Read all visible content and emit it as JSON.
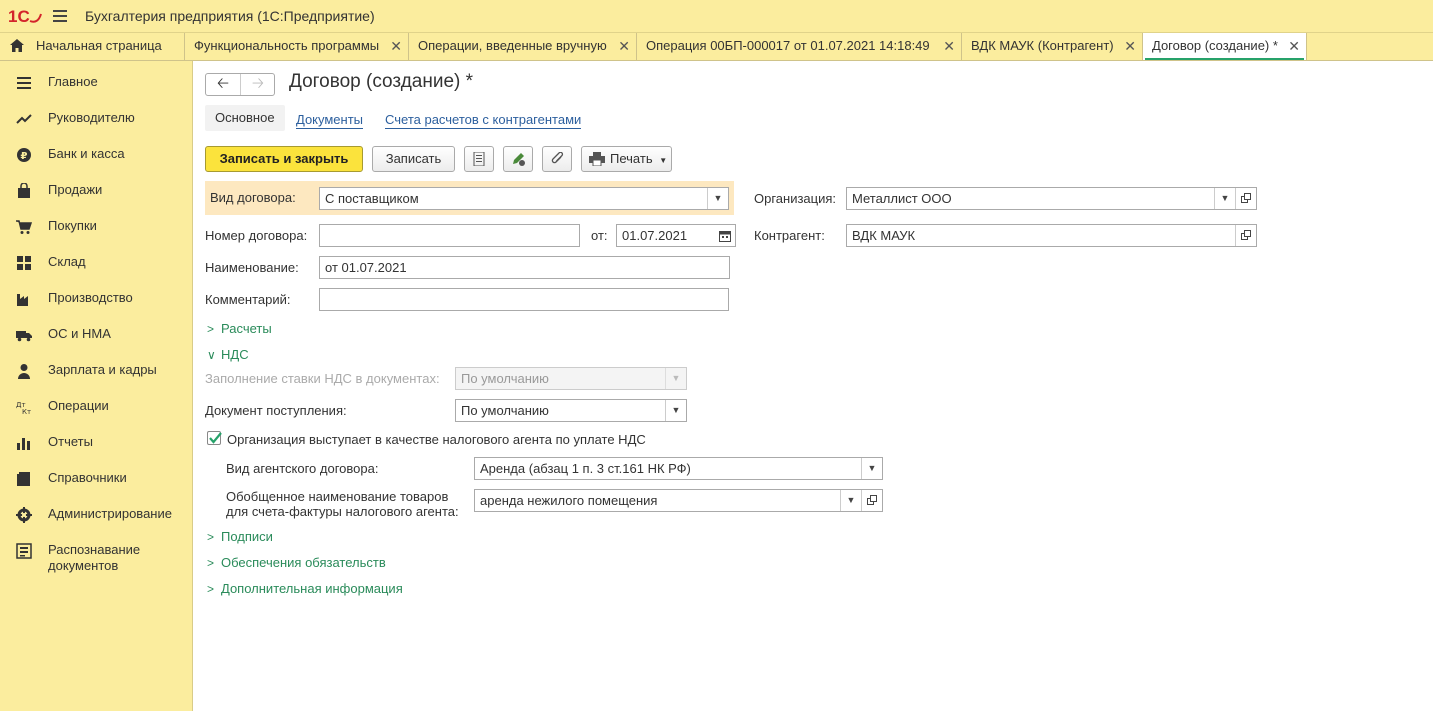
{
  "app": {
    "title": "Бухгалтерия предприятия  (1С:Предприятие)"
  },
  "tabs": [
    {
      "label": "Начальная страница",
      "closable": false
    },
    {
      "label": "Функциональность программы",
      "closable": true
    },
    {
      "label": "Операции, введенные вручную",
      "closable": true
    },
    {
      "label": "Операция 00БП-000017 от 01.07.2021 14:18:49",
      "closable": true
    },
    {
      "label": "ВДК МАУК (Контрагент)",
      "closable": true
    },
    {
      "label": "Договор (создание) *",
      "closable": true,
      "active": true
    }
  ],
  "sidebar": {
    "items": [
      {
        "label": "Главное",
        "icon": "menu-lines-icon"
      },
      {
        "label": "Руководителю",
        "icon": "trend-icon"
      },
      {
        "label": "Банк и касса",
        "icon": "ruble-coin-icon"
      },
      {
        "label": "Продажи",
        "icon": "bag-icon"
      },
      {
        "label": "Покупки",
        "icon": "cart-icon"
      },
      {
        "label": "Склад",
        "icon": "grid-icon"
      },
      {
        "label": "Производство",
        "icon": "factory-icon"
      },
      {
        "label": "ОС и НМА",
        "icon": "truck-icon"
      },
      {
        "label": "Зарплата и кадры",
        "icon": "person-icon"
      },
      {
        "label": "Операции",
        "icon": "dt-kt-icon"
      },
      {
        "label": "Отчеты",
        "icon": "bar-chart-icon"
      },
      {
        "label": "Справочники",
        "icon": "book-icon"
      },
      {
        "label": "Администрирование",
        "icon": "gear-icon"
      },
      {
        "label": "Распознавание\nдокументов",
        "icon": "scan-icon"
      }
    ]
  },
  "form": {
    "title": "Договор (создание) *",
    "subtabs": {
      "main": "Основное",
      "documents": "Документы",
      "accounts": "Счета расчетов с контрагентами"
    },
    "toolbar": {
      "save_close": "Записать и закрыть",
      "save": "Записать",
      "print": "Печать"
    },
    "fields": {
      "contract_type_label": "Вид договора:",
      "contract_type_value": "С поставщиком",
      "organization_label": "Организация:",
      "organization_value": "Металлист ООО",
      "number_label": "Номер договора:",
      "number_value": "",
      "date_label": "от:",
      "date_value": "01.07.2021",
      "counterparty_label": "Контрагент:",
      "counterparty_value": "ВДК МАУК",
      "name_label": "Наименование:",
      "name_value": "от 01.07.2021",
      "comment_label": "Комментарий:",
      "comment_value": ""
    },
    "sections": {
      "payments": "Расчеты",
      "vat": "НДС",
      "signatures": "Подписи",
      "obligations": "Обеспечения обязательств",
      "additional": "Дополнительная информация"
    },
    "vat": {
      "fill_rate_label": "Заполнение ставки НДС в документах:",
      "fill_rate_value": "По умолчанию",
      "receipt_doc_label": "Документ поступления:",
      "receipt_doc_value": "По умолчанию",
      "tax_agent_label": "Организация выступает в качестве налогового агента по уплате НДС",
      "tax_agent_checked": true,
      "agent_contract_type_label": "Вид агентского договора:",
      "agent_contract_type_value": "Аренда (абзац 1 п. 3 ст.161 НК РФ)",
      "goods_name_label_1": "Обобщенное наименование товаров",
      "goods_name_label_2": "для счета-фактуры налогового агента:",
      "goods_name_value": "аренда нежилого помещения"
    }
  },
  "colors": {
    "panel": "#fbed9e",
    "accent_green": "#26a26a",
    "primary_button": "#fbe33c",
    "highlight": "#fde8c0"
  }
}
